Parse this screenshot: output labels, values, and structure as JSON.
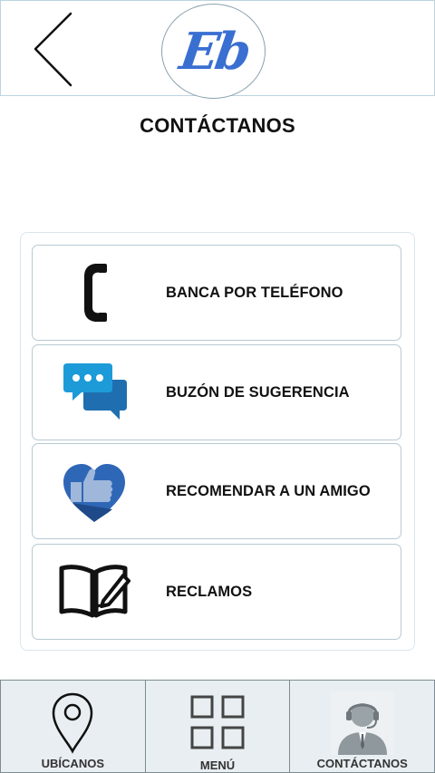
{
  "header": {
    "back_icon": "chevron-left-icon",
    "logo_text": "Eb",
    "logo_color": "#3a6fd2"
  },
  "page": {
    "title": "CONTÁCTANOS"
  },
  "options": [
    {
      "label": "BANCA POR TELÉFONO",
      "icon": "phone-icon"
    },
    {
      "label": "BUZÓN DE SUGERENCIA",
      "icon": "chat-bubbles-icon"
    },
    {
      "label": "RECOMENDAR A UN AMIGO",
      "icon": "heart-thumbs-up-icon"
    },
    {
      "label": "RECLAMOS",
      "icon": "book-pen-icon"
    }
  ],
  "bottom_nav": [
    {
      "label": "UBÍCANOS",
      "icon": "map-pin-icon"
    },
    {
      "label": "MENÚ",
      "icon": "grid-icon"
    },
    {
      "label": "CONTÁCTANOS",
      "icon": "support-agent-icon",
      "active": true
    }
  ],
  "colors": {
    "chat_blue": "#1d9bd8",
    "heart_blue": "#2f67b7",
    "nav_bg": "#e8eef1"
  }
}
